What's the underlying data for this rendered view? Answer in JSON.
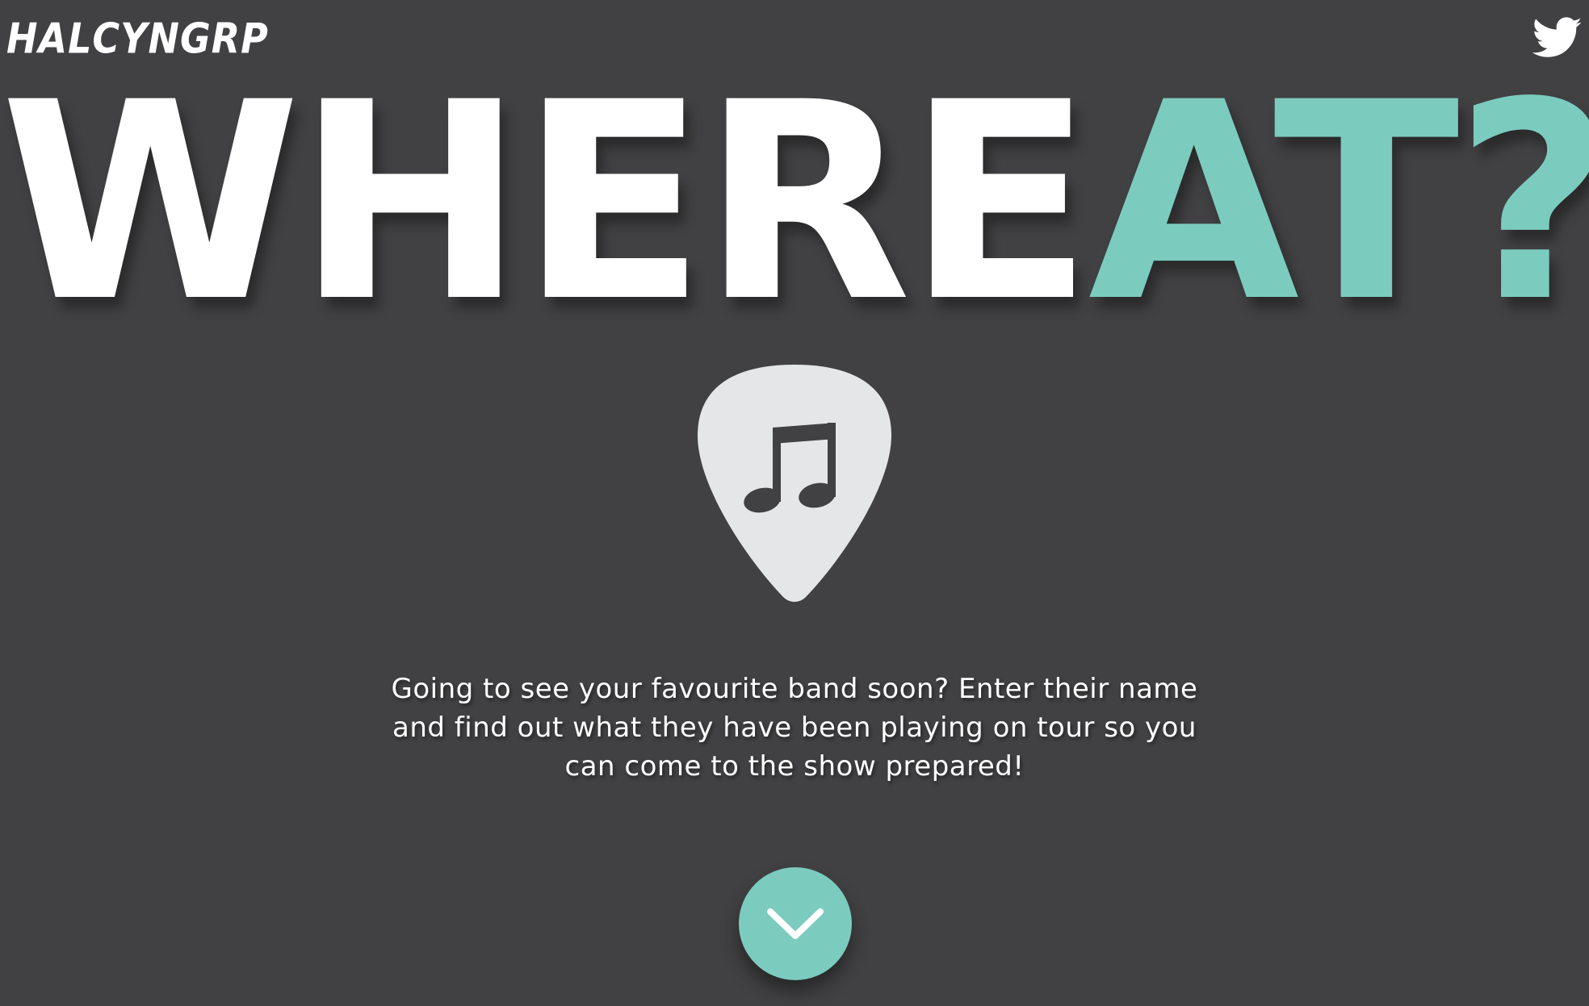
{
  "header": {
    "logo_text": "HALCYNGRP",
    "twitter_icon": "twitter-bird-icon"
  },
  "hero": {
    "title_part1": "WHERE",
    "title_part2": "AT?",
    "accent_color": "#7ccbbf",
    "pick_icon": "guitar-pick-music-note-icon"
  },
  "intro": {
    "text": "Going to see your favourite band soon? Enter their name and find out what they have been playing on tour so you can come to the show prepared!"
  },
  "scroll_button": {
    "icon": "chevron-down-icon"
  },
  "colors": {
    "background": "#414143",
    "text": "#ffffff",
    "pick": "#e5e6e8"
  }
}
